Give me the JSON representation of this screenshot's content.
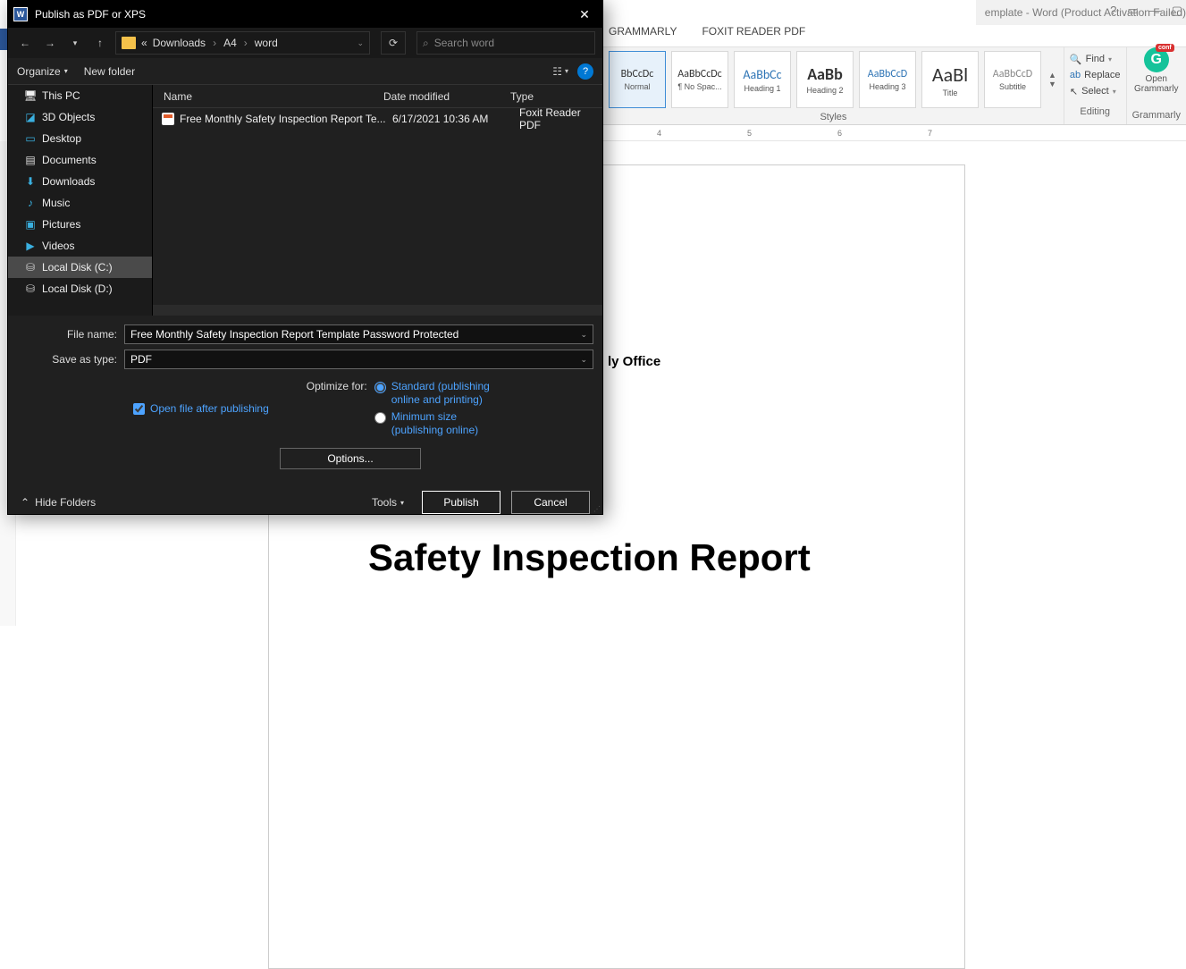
{
  "word": {
    "title": "emplate - Word (Product Activation Failed)",
    "tabs": {
      "grammarly": "GRAMMARLY",
      "foxit": "FOXIT READER PDF"
    },
    "styles": {
      "label": "Styles",
      "items": [
        {
          "sample": "BbCcDc",
          "name": "Normal",
          "selected": true
        },
        {
          "sample": "AaBbCcDc",
          "name": "¶ No Spac..."
        },
        {
          "sample": "AaBbCc",
          "name": "Heading 1"
        },
        {
          "sample": "AaBb",
          "name": "Heading 2"
        },
        {
          "sample": "AaBbCcD",
          "name": "Heading 3"
        },
        {
          "sample": "AaBl",
          "name": "Title"
        },
        {
          "sample": "AaBbCcD",
          "name": "Subtitle"
        }
      ]
    },
    "editing": {
      "label": "Editing",
      "find": "Find",
      "replace": "Replace",
      "select": "Select"
    },
    "grammarly": {
      "label": "Grammarly",
      "btn": "Open Grammarly",
      "badge": "conf"
    },
    "ruler": [
      "4",
      "5",
      "6",
      "7"
    ],
    "doc": {
      "sub": "ly Office",
      "title": "Safety Inspection Report"
    }
  },
  "dialog": {
    "title": "Publish as PDF or XPS",
    "breadcrumb": {
      "prefix": "«",
      "p1": "Downloads",
      "p2": "A4",
      "p3": "word"
    },
    "search_placeholder": "Search word",
    "organize": "Organize",
    "new_folder": "New folder",
    "tree": {
      "this_pc": "This PC",
      "objects": "3D Objects",
      "desktop": "Desktop",
      "documents": "Documents",
      "downloads": "Downloads",
      "music": "Music",
      "pictures": "Pictures",
      "videos": "Videos",
      "cdrive": "Local Disk (C:)",
      "ddrive": "Local Disk (D:)"
    },
    "columns": {
      "name": "Name",
      "date": "Date modified",
      "type": "Type"
    },
    "file": {
      "name": "Free Monthly Safety Inspection Report Te...",
      "date": "6/17/2021 10:36 AM",
      "type": "Foxit Reader PDF"
    },
    "filename_label": "File name:",
    "filename_value": "Free Monthly Safety Inspection Report Template Password Protected",
    "saveas_label": "Save as type:",
    "saveas_value": "PDF",
    "open_after": "Open file after publishing",
    "optimize_label": "Optimize for:",
    "opt_standard1": "Standard (publishing",
    "opt_standard2": "online and printing)",
    "opt_min1": "Minimum size",
    "opt_min2": "(publishing online)",
    "options_btn": "Options...",
    "hide_folders": "Hide Folders",
    "tools": "Tools",
    "publish": "Publish",
    "cancel": "Cancel"
  }
}
